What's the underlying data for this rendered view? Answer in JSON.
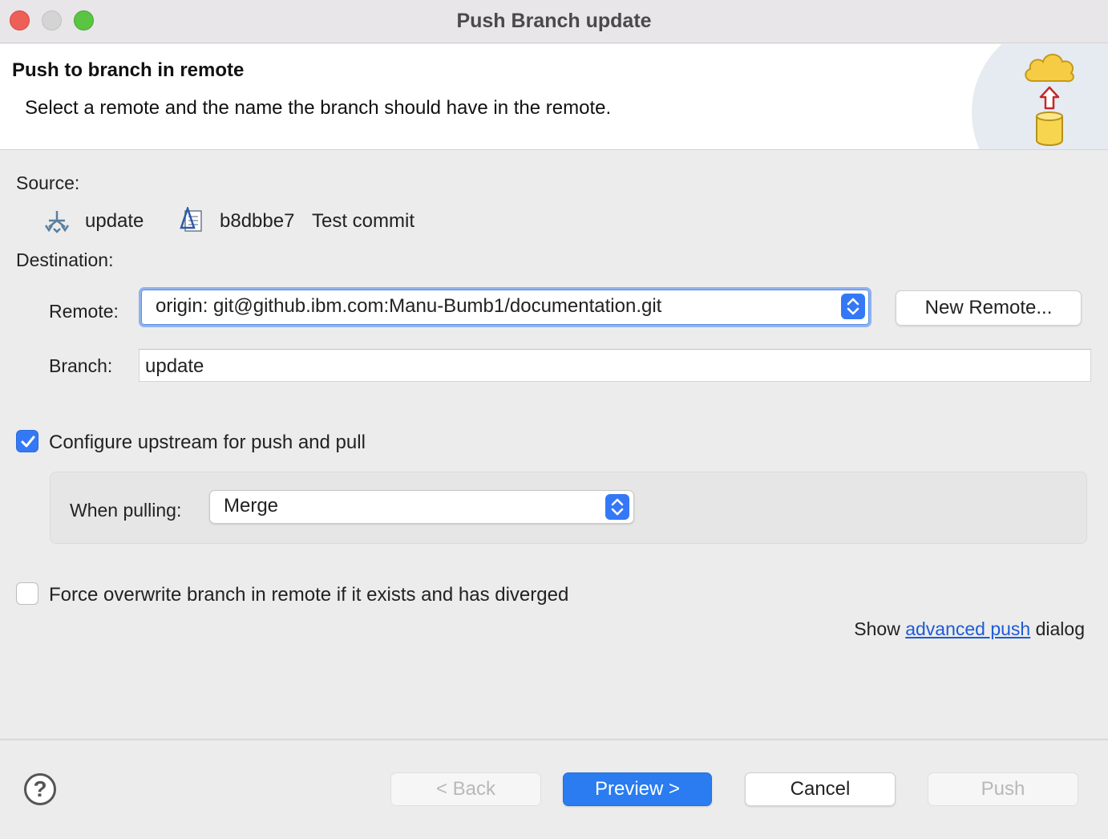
{
  "window": {
    "title": "Push Branch update"
  },
  "header": {
    "title": "Push to branch in remote",
    "description": "Select a remote and the name the branch should have in the remote.",
    "icon": "push-to-cloud-icon"
  },
  "source": {
    "label": "Source:",
    "branch_icon": "branch-icon",
    "branch": "update",
    "commit_icon": "commit-icon",
    "commit_id": "b8dbbe7",
    "commit_message": "Test commit"
  },
  "destination": {
    "label": "Destination:",
    "remote_label": "Remote:",
    "remote_value": "origin: git@github.ibm.com:Manu-Bumb1/documentation.git",
    "new_remote_button": "New Remote...",
    "branch_label": "Branch:",
    "branch_value": "update"
  },
  "upstream": {
    "checked": true,
    "label": "Configure upstream for push and pull",
    "when_pulling_label": "When pulling:",
    "when_pulling_value": "Merge"
  },
  "force": {
    "checked": false,
    "label": "Force overwrite branch in remote if it exists and has diverged"
  },
  "advanced": {
    "prefix": "Show",
    "link": "advanced push",
    "suffix": "dialog"
  },
  "footer": {
    "back": "< Back",
    "preview": "Preview >",
    "cancel": "Cancel",
    "push": "Push"
  },
  "colors": {
    "accent": "#3478f6",
    "link": "#1e5bd6"
  }
}
